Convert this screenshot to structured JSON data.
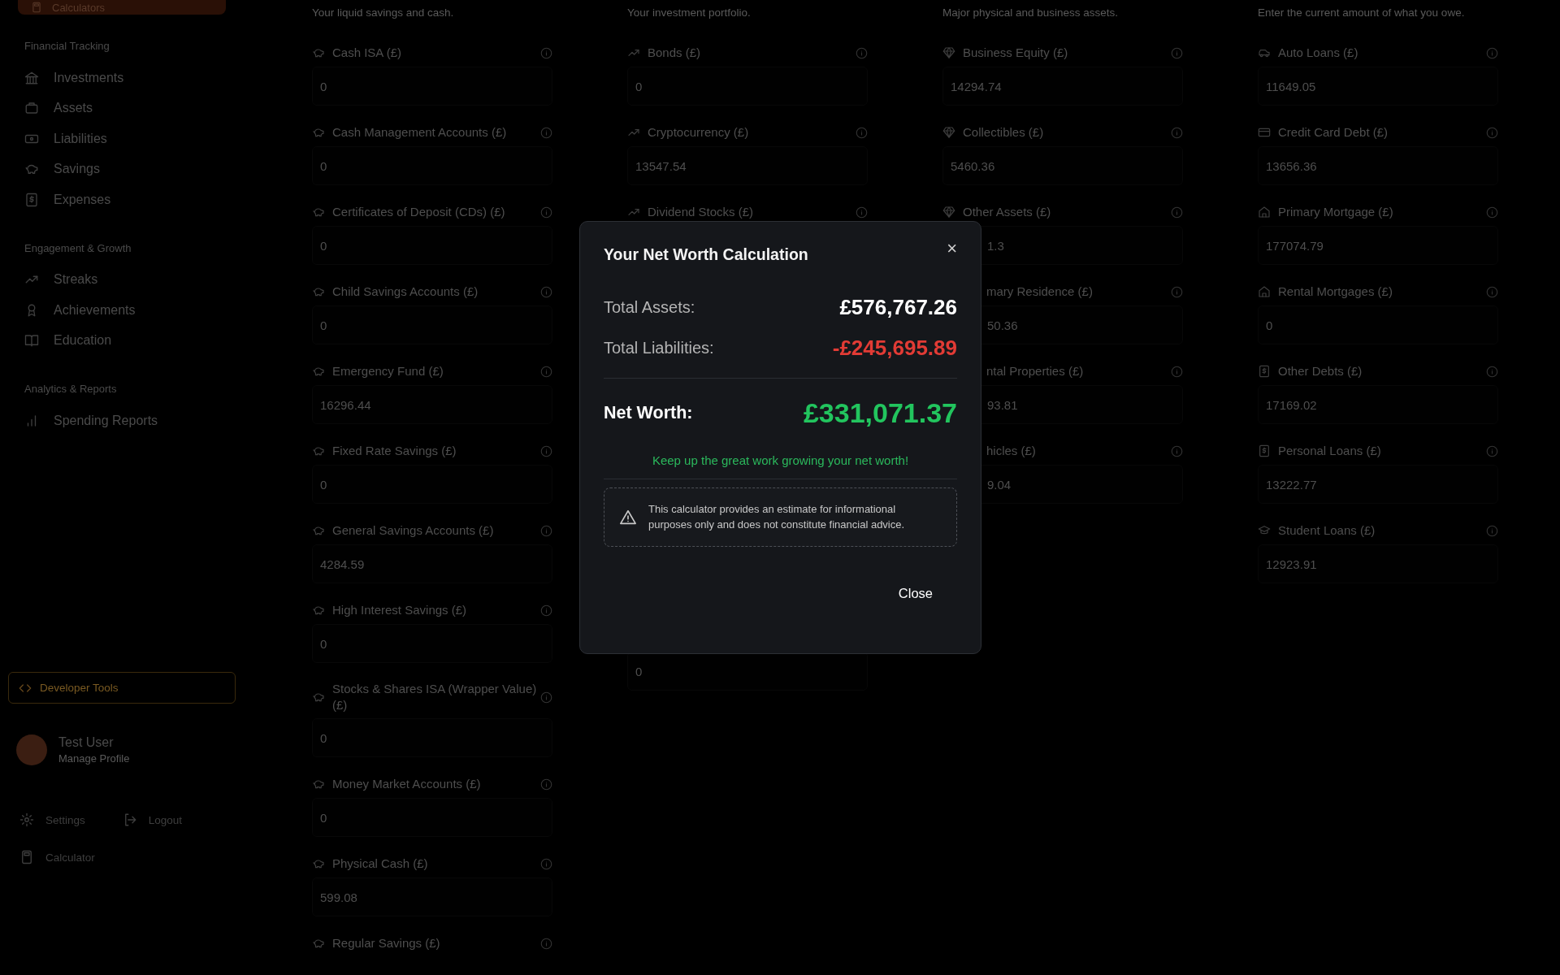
{
  "sidebar": {
    "top_button": "Calculators",
    "sections": [
      {
        "title": "Financial Tracking",
        "items": [
          "Investments",
          "Assets",
          "Liabilities",
          "Savings",
          "Expenses"
        ]
      },
      {
        "title": "Engagement & Growth",
        "items": [
          "Streaks",
          "Achievements",
          "Education"
        ]
      },
      {
        "title": "Analytics & Reports",
        "items": [
          "Spending Reports"
        ]
      }
    ],
    "developer_button": "Developer Tools",
    "user": {
      "name": "Test User",
      "link": "Manage Profile"
    },
    "footer": [
      "Settings",
      "Logout",
      "Calculator"
    ]
  },
  "columns": [
    {
      "subtitle": "Your liquid savings and cash.",
      "items": [
        {
          "label": "Cash ISA (£)",
          "value": "0"
        },
        {
          "label": "Cash Management Accounts (£)",
          "value": "0"
        },
        {
          "label": "Certificates of Deposit (CDs) (£)",
          "value": "0"
        },
        {
          "label": "Child Savings Accounts (£)",
          "value": "0"
        },
        {
          "label": "Emergency Fund (£)",
          "value": "16296.44"
        },
        {
          "label": "Fixed Rate Savings (£)",
          "value": "0"
        },
        {
          "label": "General Savings Accounts (£)",
          "value": "4284.59"
        },
        {
          "label": "High Interest Savings (£)",
          "value": "0"
        },
        {
          "label": "Stocks & Shares ISA (Wrapper Value) (£)",
          "value": "0"
        },
        {
          "label": "Money Market Accounts (£)",
          "value": "0"
        },
        {
          "label": "Physical Cash (£)",
          "value": "599.08"
        },
        {
          "label": "Regular Savings (£)"
        }
      ]
    },
    {
      "subtitle": "Your investment portfolio.",
      "items": [
        {
          "label": "Bonds (£)",
          "value": "0"
        },
        {
          "label": "Cryptocurrency (£)",
          "value": "13547.54"
        },
        {
          "label": "Dividend Stocks (£)"
        },
        {
          "value": "0"
        }
      ]
    },
    {
      "subtitle": "Major physical and business assets.",
      "items": [
        {
          "label": "Business Equity (£)",
          "value": "14294.74"
        },
        {
          "label": "Collectibles (£)",
          "value": "5460.36"
        },
        {
          "label": "Other Assets (£)",
          "value": "1.3",
          "value_partial": true
        },
        {
          "label": "mary Residence (£)",
          "value": "50.36",
          "partial": true
        },
        {
          "label": "ntal Properties (£)",
          "value": "93.81",
          "partial": true
        },
        {
          "label": "hicles (£)",
          "value": "9.04",
          "partial": true
        }
      ]
    },
    {
      "subtitle": "Enter the current amount of what you owe.",
      "items": [
        {
          "label": "Auto Loans (£)",
          "value": "11649.05"
        },
        {
          "label": "Credit Card Debt (£)",
          "value": "13656.36"
        },
        {
          "label": "Primary Mortgage (£)",
          "value": "177074.79"
        },
        {
          "label": "Rental Mortgages (£)",
          "value": "0"
        },
        {
          "label": "Other Debts (£)",
          "value": "17169.02"
        },
        {
          "label": "Personal Loans (£)",
          "value": "13222.77"
        },
        {
          "label": "Student Loans (£)",
          "value": "12923.91"
        }
      ]
    }
  ],
  "modal": {
    "title": "Your Net Worth Calculation",
    "close_icon": "×",
    "rows": [
      {
        "label": "Total Assets:",
        "value": "£576,767.26",
        "kind": "assets"
      },
      {
        "label": "Total Liabilities:",
        "value": "-£245,695.89",
        "kind": "liabilities"
      },
      {
        "label": "Net Worth:",
        "value": "£331,071.37",
        "kind": "net"
      }
    ],
    "message": "Keep up the great work growing your net worth!",
    "notice": "This calculator provides an estimate for informational purposes only and does not constitute financial advice.",
    "button": "Close"
  }
}
